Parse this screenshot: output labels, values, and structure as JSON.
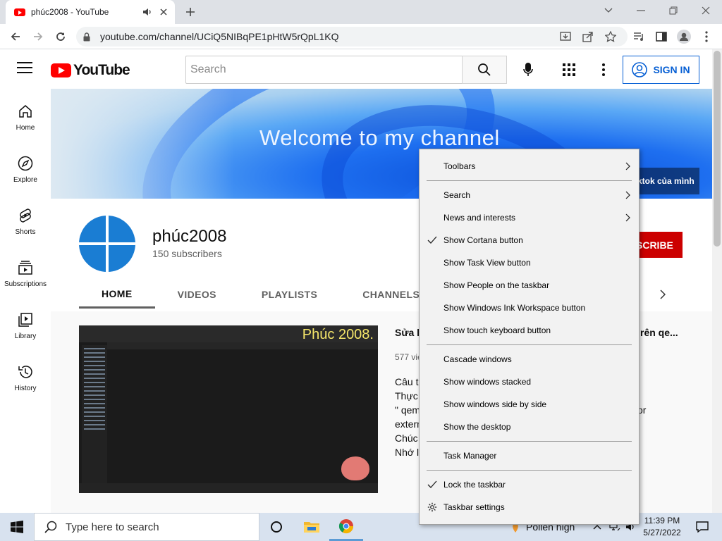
{
  "browser": {
    "tab_title": "phúc2008 - YouTube",
    "url": "youtube.com/channel/UCiQ5NIBqPE1pHtW5rQpL1KQ"
  },
  "youtube": {
    "logo_text": "YouTube",
    "search_placeholder": "Search",
    "sign_in": "SIGN IN",
    "guide": [
      {
        "label": "Home",
        "icon": "home-icon"
      },
      {
        "label": "Explore",
        "icon": "compass-icon"
      },
      {
        "label": "Shorts",
        "icon": "shorts-icon"
      },
      {
        "label": "Subscriptions",
        "icon": "subscriptions-icon"
      },
      {
        "label": "Library",
        "icon": "library-icon"
      },
      {
        "label": "History",
        "icon": "history-icon"
      }
    ],
    "banner": {
      "welcome": "Welcome to my channel",
      "link_fragment": "ktok của mình"
    },
    "channel": {
      "name": "phúc2008",
      "subscribers": "150 subscribers",
      "subscribe_fragment": "SCRIBE"
    },
    "tabs": [
      "HOME",
      "VIDEOS",
      "PLAYLISTS",
      "CHANNELS"
    ],
    "featured": {
      "thumb_brand": "Phúc 2008.",
      "title_start": "Sửa lỗ",
      "title_end": "rên qe...",
      "meta": "577 vie",
      "desc_lines": [
        "Câu t",
        "Thực",
        "\" qem",
        "extern",
        "Chúc",
        "Nhớ l"
      ],
      "desc_or": "or"
    }
  },
  "context_menu": {
    "items": [
      {
        "label": "Toolbars",
        "submenu": true,
        "checked": false
      },
      {
        "label": "Search",
        "submenu": true,
        "checked": false
      },
      {
        "label": "News and interests",
        "submenu": true,
        "checked": false
      },
      {
        "label": "Show Cortana button",
        "submenu": false,
        "checked": true
      },
      {
        "label": "Show Task View button",
        "submenu": false,
        "checked": false
      },
      {
        "label": "Show People on the taskbar",
        "submenu": false,
        "checked": false
      },
      {
        "label": "Show Windows Ink Workspace button",
        "submenu": false,
        "checked": false
      },
      {
        "label": "Show touch keyboard button",
        "submenu": false,
        "checked": false
      },
      {
        "label": "Cascade windows",
        "submenu": false,
        "checked": false
      },
      {
        "label": "Show windows stacked",
        "submenu": false,
        "checked": false
      },
      {
        "label": "Show windows side by side",
        "submenu": false,
        "checked": false
      },
      {
        "label": "Show the desktop",
        "submenu": false,
        "checked": false
      },
      {
        "label": "Task Manager",
        "submenu": false,
        "checked": false
      },
      {
        "label": "Lock the taskbar",
        "submenu": false,
        "checked": true
      },
      {
        "label": "Taskbar settings",
        "submenu": false,
        "checked": false
      }
    ]
  },
  "taskbar": {
    "search_placeholder": "Type here to search",
    "weather": "Pollen high",
    "time": "11:39 PM",
    "date": "5/27/2022"
  },
  "colors": {
    "yt_red": "#ff0000",
    "signin_blue": "#065fd4",
    "subscribe_red": "#cc0000",
    "taskbar_bg": "#d8e2ef",
    "menu_bg": "#f2f2f2"
  }
}
